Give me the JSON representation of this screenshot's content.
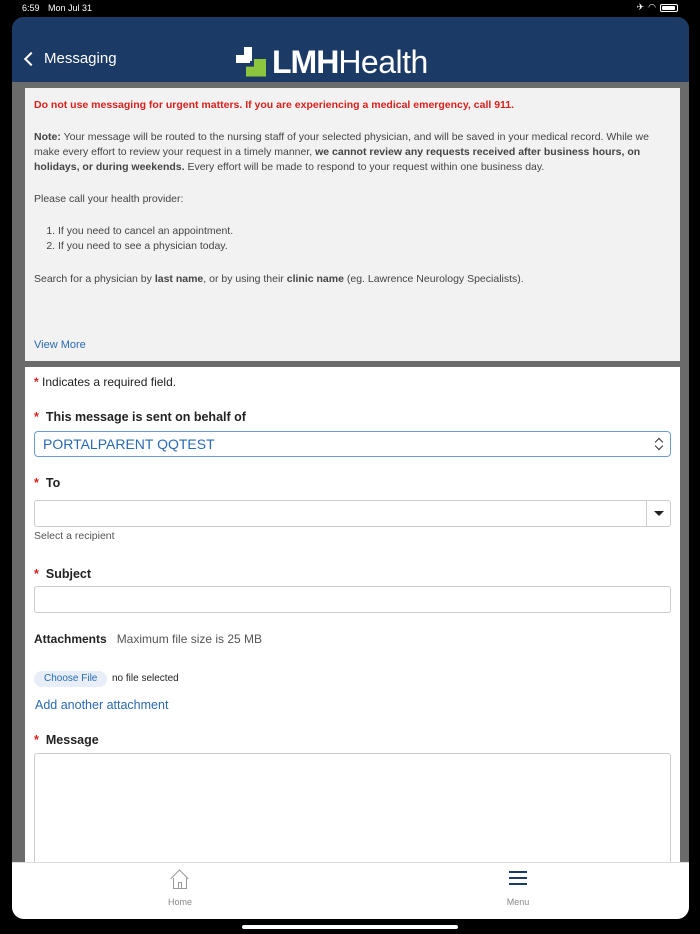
{
  "status": {
    "time": "6:59",
    "date": "Mon Jul 31"
  },
  "header": {
    "back_label": "Messaging",
    "logo_bold": "LMH",
    "logo_light": "Health"
  },
  "notice": {
    "warning": "Do not use messaging for urgent matters. If you are experiencing a medical emergency, call 911.",
    "note_label": "Note:",
    "note_text1": " Your message will be routed to the nursing staff of your selected physician, and will be saved in your medical record. While we make every effort to review your request in a timely manner, ",
    "note_bold": "we cannot review any requests received after business hours, on holidays, or during weekends.",
    "note_text2": " Every effort will be made to respond to your request within one business day.",
    "call_intro": "Please call your health provider:",
    "list": [
      "If you need to cancel an appointment.",
      "If you need to see a physician today."
    ],
    "search_a": "Search for a physician by ",
    "search_b": "last name",
    "search_c": ", or by using their ",
    "search_d": "clinic name",
    "search_e": " (eg. Lawrence Neurology Specialists).",
    "view_more": "View More"
  },
  "form": {
    "required_star": "*",
    "required_note": " Indicates a required field.",
    "behalf_label": "This message is sent on behalf of",
    "behalf_value": "PORTALPARENT QQTEST",
    "to_label": "To",
    "to_hint": "Select a recipient",
    "subject_label": "Subject",
    "attachments_label": "Attachments",
    "attachments_note": "Maximum file size is 25 MB",
    "choose_file": "Choose File",
    "no_file": "no file selected",
    "add_attachment": "Add another attachment",
    "message_label": "Message"
  },
  "tabbar": {
    "home": "Home",
    "menu": "Menu"
  }
}
